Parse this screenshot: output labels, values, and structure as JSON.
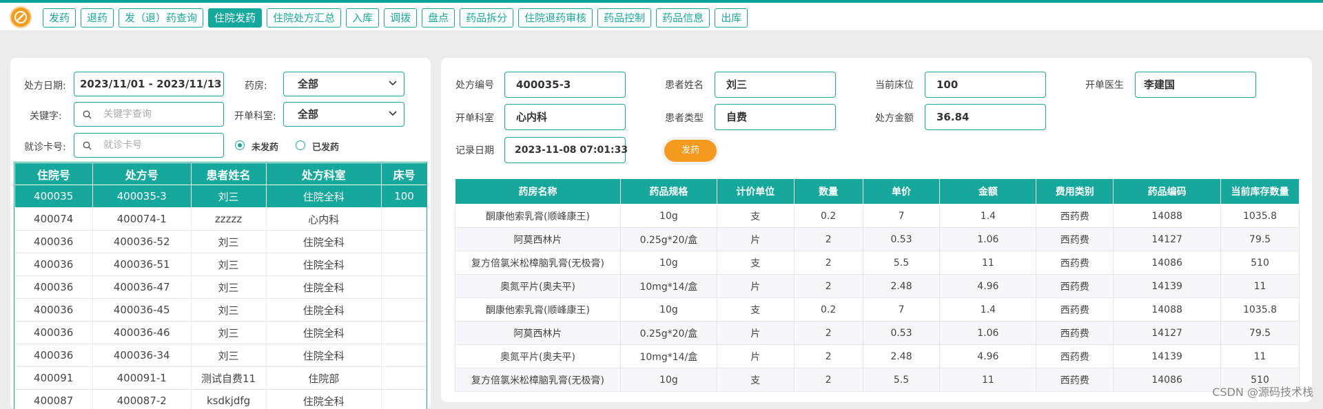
{
  "nav": {
    "items": [
      "发药",
      "退药",
      "发（退）药查询",
      "住院发药",
      "住院处方汇总",
      "入库",
      "调拨",
      "盘点",
      "药品拆分",
      "住院退药审核",
      "药品控制",
      "药品信息",
      "出库"
    ],
    "active_index": 3
  },
  "filters": {
    "date_label": "处方日期:",
    "date_value": "2023/11/01 - 2023/11/13",
    "pharmacy_label": "药房:",
    "pharmacy_value": "全部",
    "keyword_label": "关键字:",
    "keyword_placeholder": "关键字查询",
    "dept_label": "开单科室:",
    "dept_value": "全部",
    "card_label": "就诊卡号:",
    "card_placeholder": "就诊卡号",
    "radio_undispensed": "未发药",
    "radio_dispensed": "已发药"
  },
  "left_table": {
    "headers": [
      "住院号",
      "处方号",
      "患者姓名",
      "处方科室",
      "床号"
    ],
    "rows": [
      [
        "400035",
        "400035-3",
        "刘三",
        "住院全科",
        "100"
      ],
      [
        "400074",
        "400074-1",
        "zzzzz",
        "心内科",
        ""
      ],
      [
        "400036",
        "400036-52",
        "刘三",
        "住院全科",
        ""
      ],
      [
        "400036",
        "400036-51",
        "刘三",
        "住院全科",
        ""
      ],
      [
        "400036",
        "400036-47",
        "刘三",
        "住院全科",
        ""
      ],
      [
        "400036",
        "400036-45",
        "刘三",
        "住院全科",
        ""
      ],
      [
        "400036",
        "400036-46",
        "刘三",
        "住院全科",
        ""
      ],
      [
        "400036",
        "400036-34",
        "刘三",
        "住院全科",
        ""
      ],
      [
        "400091",
        "400091-1",
        "测试自费11",
        "住院部",
        ""
      ],
      [
        "400087",
        "400087-2",
        "ksdkjdfg",
        "住院全科",
        ""
      ]
    ],
    "selected_index": 0
  },
  "detail": {
    "rx_no_label": "处方编号",
    "rx_no": "400035-3",
    "patient_label": "患者姓名",
    "patient": "刘三",
    "bed_label": "当前床位",
    "bed": "100",
    "doctor_label": "开单医生",
    "doctor": "李建国",
    "dept_label": "开单科室",
    "dept": "心内科",
    "ptype_label": "患者类型",
    "ptype": "自费",
    "amount_label": "处方金额",
    "amount": "36.84",
    "record_label": "记录日期",
    "record": "2023-11-08 07:01:33",
    "dispense_button": "发药"
  },
  "drug_table": {
    "headers": [
      "药房名称",
      "药品规格",
      "计价单位",
      "数量",
      "单价",
      "金额",
      "费用类别",
      "药品编码",
      "当前库存数量"
    ],
    "rows": [
      [
        "酮康他索乳膏(顺峰康王)",
        "10g",
        "支",
        "0.2",
        "7",
        "1.4",
        "西药费",
        "14088",
        "1035.8"
      ],
      [
        "阿莫西林片",
        "0.25g*20/盒",
        "片",
        "2",
        "0.53",
        "1.06",
        "西药费",
        "14127",
        "79.5"
      ],
      [
        "复方倍氯米松樟脑乳膏(无极膏)",
        "10g",
        "支",
        "2",
        "5.5",
        "11",
        "西药费",
        "14086",
        "510"
      ],
      [
        "奥氮平片(奥夫平)",
        "10mg*14/盒",
        "片",
        "2",
        "2.48",
        "4.96",
        "西药费",
        "14139",
        "11"
      ],
      [
        "酮康他索乳膏(顺峰康王)",
        "10g",
        "支",
        "0.2",
        "7",
        "1.4",
        "西药费",
        "14088",
        "1035.8"
      ],
      [
        "阿莫西林片",
        "0.25g*20/盒",
        "片",
        "2",
        "0.53",
        "1.06",
        "西药费",
        "14127",
        "79.5"
      ],
      [
        "奥氮平片(奥夫平)",
        "10mg*14/盒",
        "片",
        "2",
        "2.48",
        "4.96",
        "西药费",
        "14139",
        "11"
      ],
      [
        "复方倍氯米松樟脑乳膏(无极膏)",
        "10g",
        "支",
        "2",
        "5.5",
        "11",
        "西药费",
        "14086",
        "510"
      ]
    ]
  },
  "watermark": "CSDN @源码技术栈",
  "colors": {
    "accent": "#16a89d",
    "orange": "#f39a1f"
  }
}
